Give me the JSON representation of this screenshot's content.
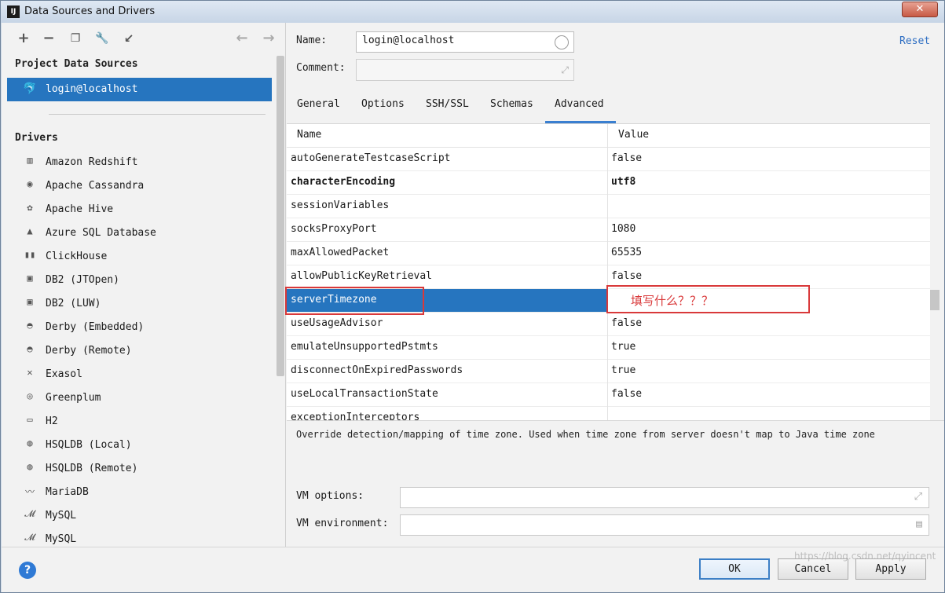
{
  "window": {
    "title": "Data Sources and Drivers",
    "app_icon": "IJ"
  },
  "left": {
    "project_title": "Project Data Sources",
    "data_sources": [
      {
        "label": "login@localhost",
        "icon": "mysql-dolphin-icon"
      }
    ],
    "drivers_title": "Drivers",
    "drivers": [
      {
        "label": "Amazon Redshift",
        "icon": "redshift-icon"
      },
      {
        "label": "Apache Cassandra",
        "icon": "cassandra-eye-icon"
      },
      {
        "label": "Apache Hive",
        "icon": "hive-bee-icon"
      },
      {
        "label": "Azure SQL Database",
        "icon": "azure-icon"
      },
      {
        "label": "ClickHouse",
        "icon": "clickhouse-bars-icon"
      },
      {
        "label": "DB2 (JTOpen)",
        "icon": "ibm-db2-icon"
      },
      {
        "label": "DB2 (LUW)",
        "icon": "ibm-db2-icon"
      },
      {
        "label": "Derby (Embedded)",
        "icon": "derby-hat-icon"
      },
      {
        "label": "Derby (Remote)",
        "icon": "derby-hat-icon"
      },
      {
        "label": "Exasol",
        "icon": "exasol-x-icon"
      },
      {
        "label": "Greenplum",
        "icon": "greenplum-icon"
      },
      {
        "label": "H2",
        "icon": "h2-icon"
      },
      {
        "label": "HSQLDB (Local)",
        "icon": "hsqldb-icon"
      },
      {
        "label": "HSQLDB (Remote)",
        "icon": "hsqldb-icon"
      },
      {
        "label": "MariaDB",
        "icon": "mariadb-seal-icon"
      },
      {
        "label": "MySQL",
        "icon": "mysql-dolphin-icon"
      },
      {
        "label": "MySQL",
        "icon": "mysql-dolphin-icon"
      }
    ]
  },
  "form": {
    "name_label": "Name:",
    "name_value": "login@localhost",
    "comment_label": "Comment:",
    "comment_value": "",
    "reset_label": "Reset"
  },
  "tabs": [
    "General",
    "Options",
    "SSH/SSL",
    "Schemas",
    "Advanced"
  ],
  "active_tab": "Advanced",
  "table": {
    "col_name": "Name",
    "col_value": "Value",
    "rows": [
      {
        "name": "autoGenerateTestcaseScript",
        "value": "false"
      },
      {
        "name": "characterEncoding",
        "value": "utf8"
      },
      {
        "name": "sessionVariables",
        "value": ""
      },
      {
        "name": "socksProxyPort",
        "value": "1080"
      },
      {
        "name": "maxAllowedPacket",
        "value": "65535"
      },
      {
        "name": "allowPublicKeyRetrieval",
        "value": "false"
      },
      {
        "name": "serverTimezone",
        "value": ""
      },
      {
        "name": "useUsageAdvisor",
        "value": "false"
      },
      {
        "name": "emulateUnsupportedPstmts",
        "value": "true"
      },
      {
        "name": "disconnectOnExpiredPasswords",
        "value": "true"
      },
      {
        "name": "useLocalTransactionState",
        "value": "false"
      },
      {
        "name": "exceptionInterceptors",
        "value": ""
      }
    ]
  },
  "annotation": "填写什么？？？",
  "description": "Override detection/mapping of time zone. Used when time zone from server doesn't map to Java time zone",
  "vm": {
    "options_label": "VM options:",
    "options_value": "",
    "environment_label": "VM environment:",
    "environment_value": ""
  },
  "buttons": {
    "ok": "OK",
    "cancel": "Cancel",
    "apply": "Apply",
    "help": "?"
  },
  "watermark": "https://blog.csdn.net/qyincent",
  "colors": {
    "selection": "#2675bf",
    "accent_link": "#2f6fc3",
    "annotation_red": "#d9393a"
  }
}
